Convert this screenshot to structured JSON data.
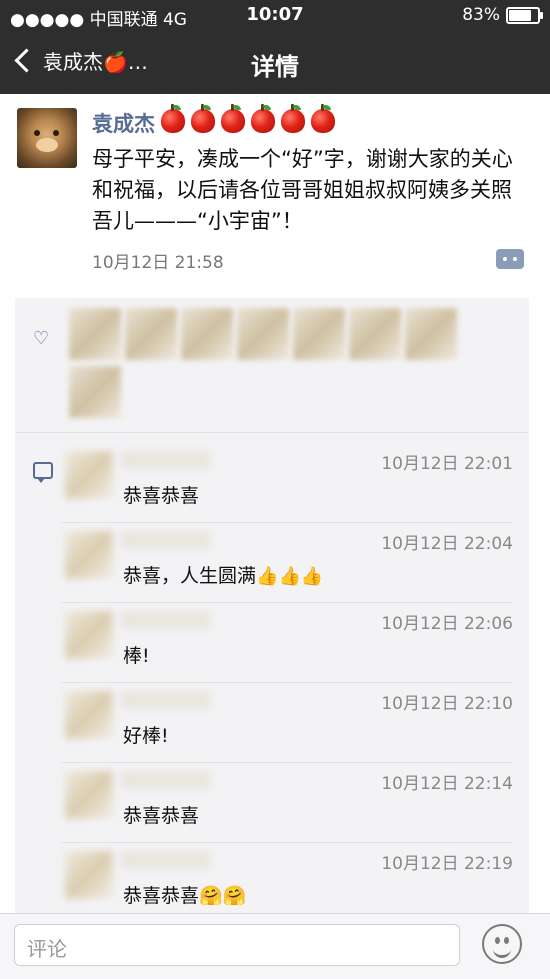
{
  "status_bar": {
    "carrier": "●●●●● 中国联通  4G",
    "time": "10:07",
    "battery_text": "83%",
    "battery_level": 0.83
  },
  "nav": {
    "back_label": "袁成杰🍎…",
    "title": "详情"
  },
  "post": {
    "author": "袁成杰",
    "author_badge_icon": "red-apple-icon",
    "author_badge_count": 6,
    "text": "母子平安，凑成一个“好”字，谢谢大家的关心和祝福，以后请各位哥哥姐姐叔叔阿姨多关照吾儿———“小宇宙”！",
    "time": "10月12日 21:58"
  },
  "comments": [
    {
      "time": "10月12日 22:01",
      "text": "恭喜恭喜",
      "emoji": []
    },
    {
      "time": "10月12日 22:04",
      "text": "恭喜，人生圆满",
      "emoji": [
        "👍",
        "👍",
        "👍"
      ]
    },
    {
      "time": "10月12日 22:06",
      "text": "棒!",
      "emoji": []
    },
    {
      "time": "10月12日 22:10",
      "text": "好棒!",
      "emoji": []
    },
    {
      "time": "10月12日 22:14",
      "text": "恭喜恭喜",
      "emoji": []
    },
    {
      "time": "10月12日 22:19",
      "text": "恭喜恭喜",
      "emoji": [
        "🤗",
        "🤗"
      ]
    }
  ],
  "bottom": {
    "placeholder": "评论"
  },
  "colors": {
    "bar": "#2e2e2e",
    "link": "#576b95",
    "panel": "#f3f3f5"
  }
}
